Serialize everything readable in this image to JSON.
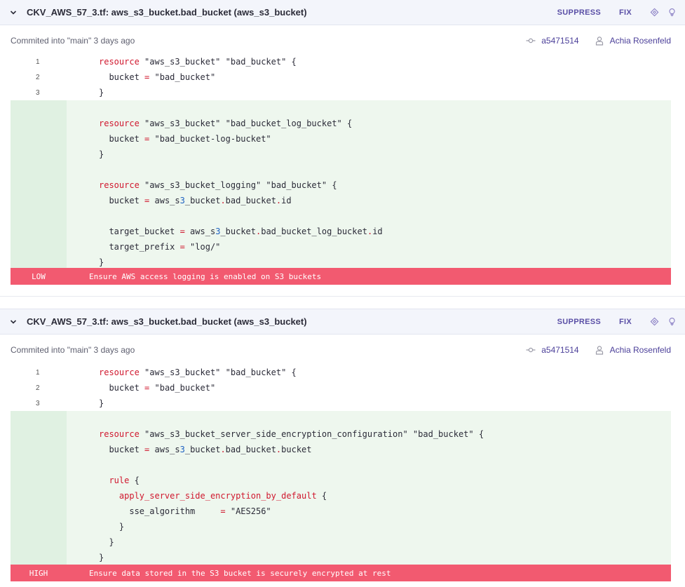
{
  "panels": [
    {
      "title": "CKV_AWS_57_3.tf: aws_s3_bucket.bad_bucket (aws_s3_bucket)",
      "suppress_label": "SUPPRESS",
      "fix_label": "FIX",
      "commit_text": "Commited into \"main\" 3 days ago",
      "commit_hash": "a5471514",
      "author": "Achia Rosenfeld",
      "severity": "LOW",
      "message": "Ensure AWS access logging is enabled on S3 buckets",
      "lines": [
        {
          "num": "1",
          "text": "resource \"aws_s3_bucket\" \"bad_bucket\" {"
        },
        {
          "num": "2",
          "text": "  bucket = \"bad_bucket\""
        },
        {
          "num": "3",
          "text": "}"
        },
        {
          "num": "",
          "text": ""
        },
        {
          "num": "",
          "text": "resource \"aws_s3_bucket\" \"bad_bucket_log_bucket\" {"
        },
        {
          "num": "",
          "text": "  bucket = \"bad_bucket-log-bucket\""
        },
        {
          "num": "",
          "text": "}"
        },
        {
          "num": "",
          "text": ""
        },
        {
          "num": "",
          "text": "resource \"aws_s3_bucket_logging\" \"bad_bucket\" {"
        },
        {
          "num": "",
          "text": "  bucket = aws_s3_bucket.bad_bucket.id"
        },
        {
          "num": "",
          "text": ""
        },
        {
          "num": "",
          "text": "  target_bucket = aws_s3_bucket.bad_bucket_log_bucket.id"
        },
        {
          "num": "",
          "text": "  target_prefix = \"log/\""
        },
        {
          "num": "",
          "text": "}"
        }
      ]
    },
    {
      "title": "CKV_AWS_57_3.tf: aws_s3_bucket.bad_bucket (aws_s3_bucket)",
      "suppress_label": "SUPPRESS",
      "fix_label": "FIX",
      "commit_text": "Commited into \"main\" 3 days ago",
      "commit_hash": "a5471514",
      "author": "Achia Rosenfeld",
      "severity": "HIGH",
      "message": "Ensure data stored in the S3 bucket is securely encrypted at rest",
      "lines": [
        {
          "num": "1",
          "text": "resource \"aws_s3_bucket\" \"bad_bucket\" {"
        },
        {
          "num": "2",
          "text": "  bucket = \"bad_bucket\""
        },
        {
          "num": "3",
          "text": "}"
        },
        {
          "num": "",
          "text": ""
        },
        {
          "num": "",
          "text": "resource \"aws_s3_bucket_server_side_encryption_configuration\" \"bad_bucket\" {"
        },
        {
          "num": "",
          "text": "  bucket = aws_s3_bucket.bad_bucket.bucket"
        },
        {
          "num": "",
          "text": ""
        },
        {
          "num": "",
          "text": "  rule {"
        },
        {
          "num": "",
          "text": "    apply_server_side_encryption_by_default {"
        },
        {
          "num": "",
          "text": "      sse_algorithm     = \"AES256\""
        },
        {
          "num": "",
          "text": "    }"
        },
        {
          "num": "",
          "text": "  }"
        },
        {
          "num": "",
          "text": "}"
        }
      ]
    }
  ],
  "colors": {
    "accent": "#5a4fa6",
    "severity_bar": "#f25a70",
    "added_bg": "#eef7ee",
    "keyword": "#d0182e"
  },
  "icons": [
    "chevron-down-icon",
    "diamond-icon",
    "lightbulb-icon",
    "commit-icon",
    "user-icon"
  ]
}
